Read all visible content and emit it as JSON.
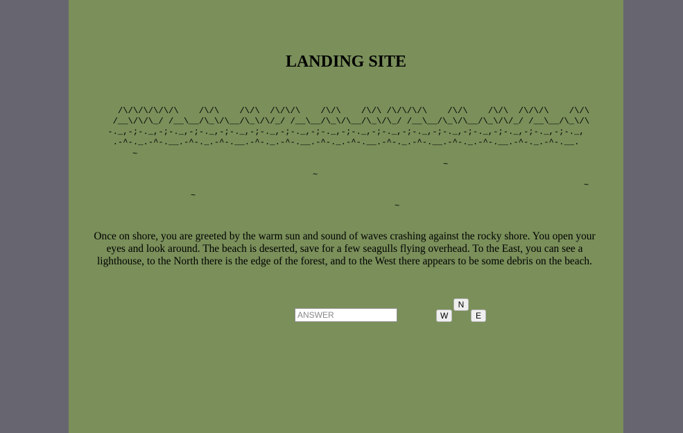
{
  "page": {
    "title": "LANDING SITE",
    "ascii_art": "   /\\/\\/\\/\\/\\/\\    /\\/\\    /\\/\\  /\\/\\/\\    /\\/\\    /\\/\\ /\\/\\/\\/\\    /\\/\\    /\\/\\  /\\/\\/\\    /\\/\\\n  /__\\/\\/\\_/ /__\\__/\\_\\/\\__/\\_\\/\\/_/ /__\\__/\\_\\/\\__/\\_\\/\\_/ /__\\__/\\_\\/\\__/\\_\\/\\/_/ /__\\__/\\_\\/\\\n-._,-;-._,-;-._,-;-._,-;-._,-;-._,-;-._,-;-._,-;-._,-;-._,-;-._,-;-._,-;-._,-;-._,-;-._,-;-._,\n.-^-._.-^-.__.-^-._.-^-.__.-^-._.-^-.__.-^-._.-^-.__.-^-._.-^-.__.-^-._.-^-.__.-^-._.-^-.__.",
    "waves": [
      "~",
      "~",
      "~",
      "~",
      "~",
      "~"
    ],
    "story": "Once on shore, you are greeted by the warm sun and sound of waves crashing against the rocky shore.  You open your eyes and look around. The beach is deserted, save for a few seagulls flying overhead.  To the East, you can see a lighthouse, to the North there is the edge of the forest, and to the West there appears to be some debris on the beach."
  },
  "answer_input": {
    "value": "",
    "placeholder": "ANSWER"
  },
  "compass": {
    "north_label": "N",
    "west_label": "W",
    "east_label": "E"
  },
  "colors": {
    "page_background": "#676670",
    "panel_background": "#7a8f5a"
  }
}
